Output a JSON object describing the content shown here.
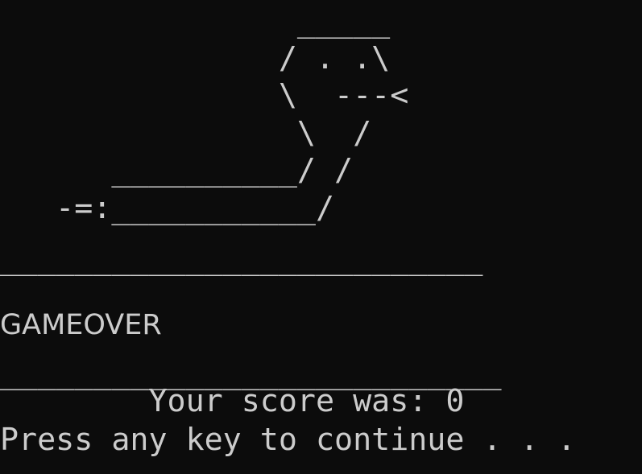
{
  "console": {
    "snake_art": [
      "                _____",
      "               / . .\\",
      "               \\  ---<",
      "                \\  /",
      "      __________/ /",
      "   -=:___________/"
    ],
    "divider_top": "__________________________",
    "gameover_text": "GAMEOVER",
    "divider_bottom": "___________________________",
    "score_line": "        Your score was: 0",
    "continue_prompt": "Press any key to continue . . ."
  },
  "colors": {
    "background": "#0c0c0c",
    "text": "#cccccc"
  }
}
